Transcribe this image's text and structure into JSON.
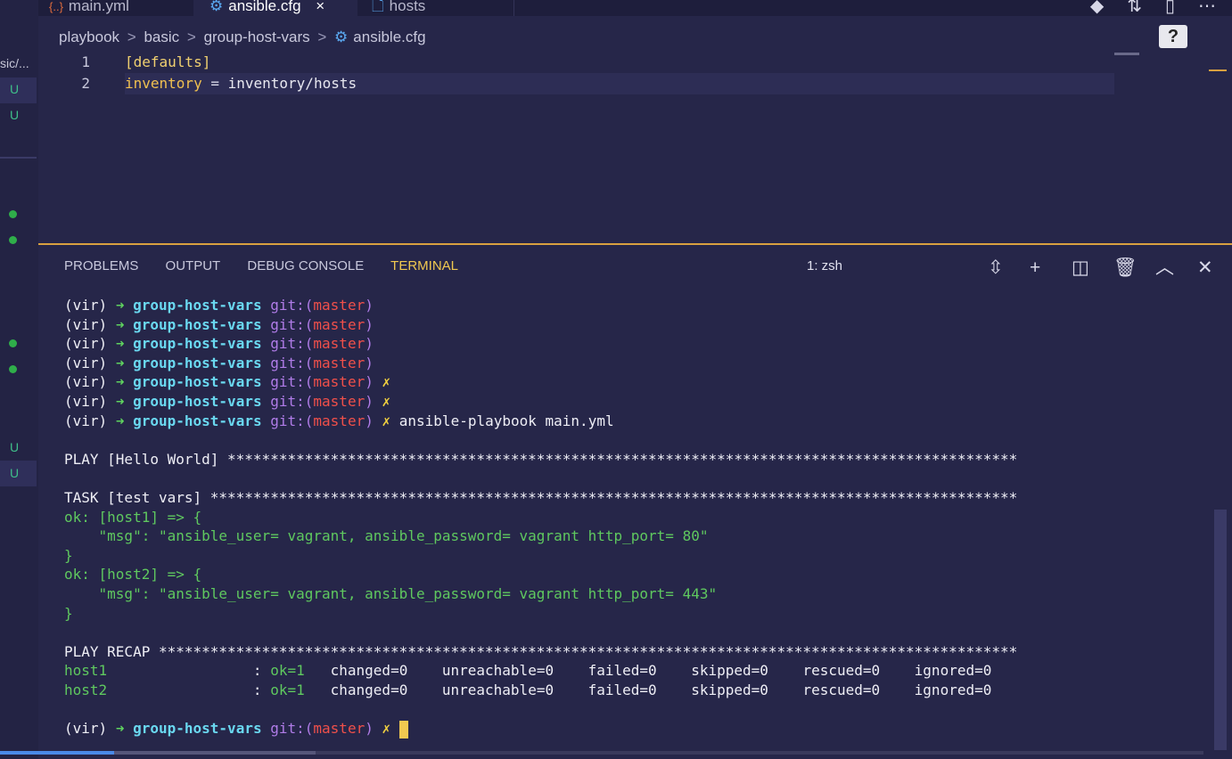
{
  "tabs": {
    "main": {
      "label": "main.yml"
    },
    "cfg": {
      "label": "ansible.cfg",
      "close": "×"
    },
    "hosts": {
      "label": "hosts"
    }
  },
  "breadcrumb": [
    "playbook",
    "basic",
    "group-host-vars",
    "ansible.cfg"
  ],
  "breadcrumb_sep": ">",
  "sidebar": {
    "path_fragment": "sic/...",
    "badges": [
      "U",
      "U",
      "U",
      "U"
    ]
  },
  "help_label": "?",
  "editor": {
    "lines": [
      {
        "num": "1",
        "section": "[defaults]"
      },
      {
        "num": "2",
        "key": "inventory",
        "eq": " = ",
        "value": "inventory/hosts"
      }
    ]
  },
  "panel": {
    "tabs": [
      "PROBLEMS",
      "OUTPUT",
      "DEBUG CONSOLE",
      "TERMINAL"
    ],
    "active_tab": "TERMINAL",
    "terminal_select": "1: zsh"
  },
  "prompt": {
    "env": "(vir)",
    "arrow": "➜",
    "dir": "group-host-vars",
    "git": "git:(",
    "branch": "master",
    "git_close": ")",
    "dirty": "✗"
  },
  "terminal": {
    "command": "ansible-playbook main.yml",
    "play_line": "PLAY [Hello World] ********************************************************************************************",
    "task_line": "TASK [test vars] **********************************************************************************************",
    "ok_host1": "ok: [host1] => {",
    "msg1": "    \"msg\": \"ansible_user= vagrant, ansible_password= vagrant http_port= 80\"",
    "close1": "}",
    "ok_host2": "ok: [host2] => {",
    "msg2": "    \"msg\": \"ansible_user= vagrant, ansible_password= vagrant http_port= 443\"",
    "close2": "}",
    "recap_line": "PLAY RECAP ****************************************************************************************************",
    "recap": [
      {
        "host": "host1",
        "ok": "ok=1",
        "rest": "   changed=0    unreachable=0    failed=0    skipped=0    rescued=0    ignored=0"
      },
      {
        "host": "host2",
        "ok": "ok=1",
        "rest": "   changed=0    unreachable=0    failed=0    skipped=0    rescued=0    ignored=0"
      }
    ],
    "recap_colon": "                 : "
  },
  "colors": {
    "background": "#262649",
    "accent": "#f0c850",
    "prompt_arrow": "#5fd35f",
    "prompt_dir": "#6ad8f0",
    "git_label": "#b07ce8",
    "branch": "#f0504a",
    "ok_green": "#5fc85f"
  }
}
